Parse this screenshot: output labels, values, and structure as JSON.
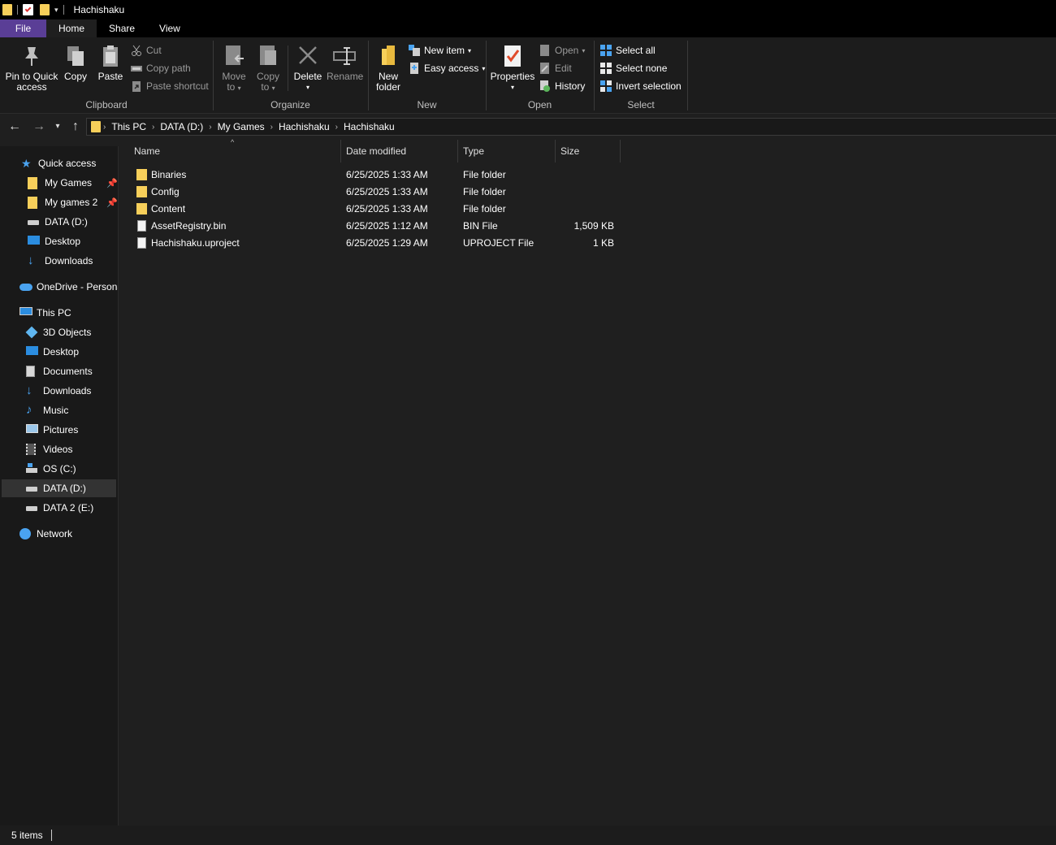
{
  "window": {
    "title": "Hachishaku"
  },
  "tabs": [
    "File",
    "Home",
    "Share",
    "View"
  ],
  "ribbon": {
    "clipboard": {
      "label": "Clipboard",
      "pin": "Pin to Quick access",
      "pin_line1": "Pin to Quick",
      "pin_line2": "access",
      "copy": "Copy",
      "paste": "Paste",
      "cut": "Cut",
      "copy_path": "Copy path",
      "paste_shortcut": "Paste shortcut"
    },
    "organize": {
      "label": "Organize",
      "move_line1": "Move",
      "move_line2": "to",
      "copy_line1": "Copy",
      "copy_line2": "to",
      "delete": "Delete",
      "rename": "Rename"
    },
    "new": {
      "label": "New",
      "new_folder_line1": "New",
      "new_folder_line2": "folder",
      "new_item": "New item",
      "easy_access": "Easy access"
    },
    "open": {
      "label": "Open",
      "properties": "Properties",
      "open": "Open",
      "edit": "Edit",
      "history": "History"
    },
    "select": {
      "label": "Select",
      "select_all": "Select all",
      "select_none": "Select none",
      "invert": "Invert selection"
    }
  },
  "breadcrumb": [
    "This PC",
    "DATA (D:)",
    "My Games",
    "Hachishaku",
    "Hachishaku"
  ],
  "nav": {
    "quick_access": "Quick access",
    "qa_items": [
      "My Games",
      "My games 2",
      "DATA (D:)",
      "Desktop",
      "Downloads"
    ],
    "onedrive": "OneDrive - Persona",
    "this_pc": "This PC",
    "pc_items": [
      "3D Objects",
      "Desktop",
      "Documents",
      "Downloads",
      "Music",
      "Pictures",
      "Videos",
      "OS (C:)",
      "DATA (D:)",
      "DATA 2 (E:)"
    ],
    "network": "Network"
  },
  "columns": {
    "name": "Name",
    "date": "Date modified",
    "type": "Type",
    "size": "Size"
  },
  "files": [
    {
      "name": "Binaries",
      "date": "6/25/2025 1:33 AM",
      "type": "File folder",
      "size": ""
    },
    {
      "name": "Config",
      "date": "6/25/2025 1:33 AM",
      "type": "File folder",
      "size": ""
    },
    {
      "name": "Content",
      "date": "6/25/2025 1:33 AM",
      "type": "File folder",
      "size": ""
    },
    {
      "name": "AssetRegistry.bin",
      "date": "6/25/2025 1:12 AM",
      "type": "BIN File",
      "size": "1,509 KB"
    },
    {
      "name": "Hachishaku.uproject",
      "date": "6/25/2025 1:29 AM",
      "type": "UPROJECT File",
      "size": "1 KB"
    }
  ],
  "status": {
    "count": "5 items"
  },
  "colors": {
    "folder": "#f7cf5a",
    "file_tab": "#5a3e96",
    "accent_blue": "#4aa3f0"
  }
}
